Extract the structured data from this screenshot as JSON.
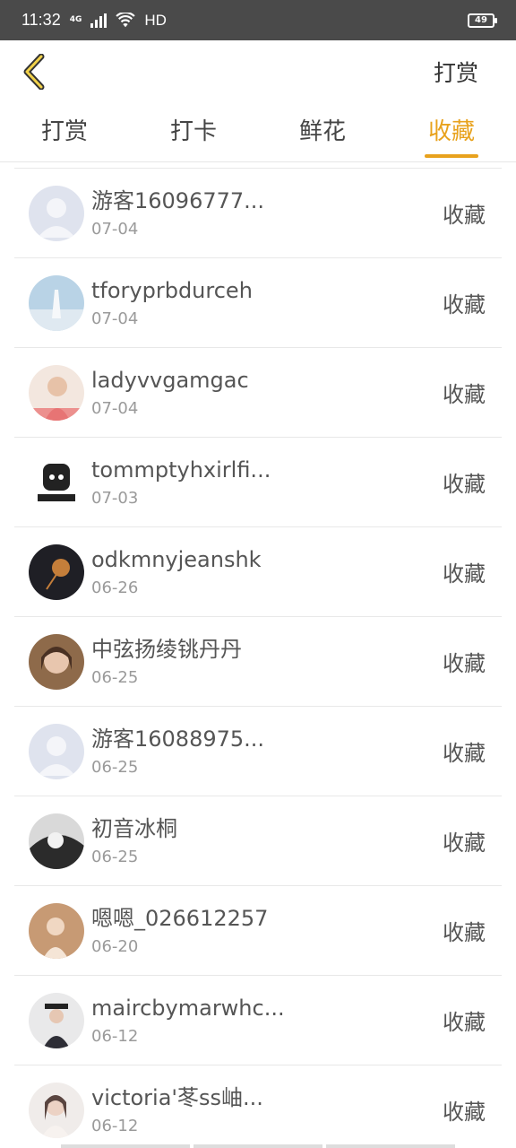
{
  "status_bar": {
    "time": "11:32",
    "network": "4G",
    "hd": "HD",
    "battery": "49"
  },
  "nav": {
    "back_icon": "chevron-left-icon",
    "action_label": "打赏"
  },
  "tabs": [
    {
      "label": "打赏",
      "active": false
    },
    {
      "label": "打卡",
      "active": false
    },
    {
      "label": "鲜花",
      "active": false
    },
    {
      "label": "收藏",
      "active": true
    }
  ],
  "colors": {
    "accent": "#e8a21d",
    "status_bar": "#4a4a4a",
    "text": "#555555",
    "subtext": "#9a9a9a"
  },
  "records": [
    {
      "name": "游客16096777...",
      "date": "07-04",
      "type": "收藏",
      "avatar": "default"
    },
    {
      "name": "tforyprbdurceh",
      "date": "07-04",
      "type": "收藏",
      "avatar": "sky"
    },
    {
      "name": "ladyvvgamgac",
      "date": "07-04",
      "type": "收藏",
      "avatar": "girl-pink"
    },
    {
      "name": "tommptyhxirlfi...",
      "date": "07-03",
      "type": "收藏",
      "avatar": "meme"
    },
    {
      "name": "odkmnyjeanshk",
      "date": "06-26",
      "type": "收藏",
      "avatar": "dark"
    },
    {
      "name": "中弦扬绫铫丹丹",
      "date": "06-25",
      "type": "收藏",
      "avatar": "girl-brown"
    },
    {
      "name": "游客16088975...",
      "date": "06-25",
      "type": "收藏",
      "avatar": "default"
    },
    {
      "name": "初音冰桐",
      "date": "06-25",
      "type": "收藏",
      "avatar": "mono"
    },
    {
      "name": "嗯嗯_026612257",
      "date": "06-20",
      "type": "收藏",
      "avatar": "warm"
    },
    {
      "name": "maircbymarwhc...",
      "date": "06-12",
      "type": "收藏",
      "avatar": "hat"
    },
    {
      "name": "victoria'苳ss岫...",
      "date": "06-12",
      "type": "收藏",
      "avatar": "light"
    }
  ]
}
